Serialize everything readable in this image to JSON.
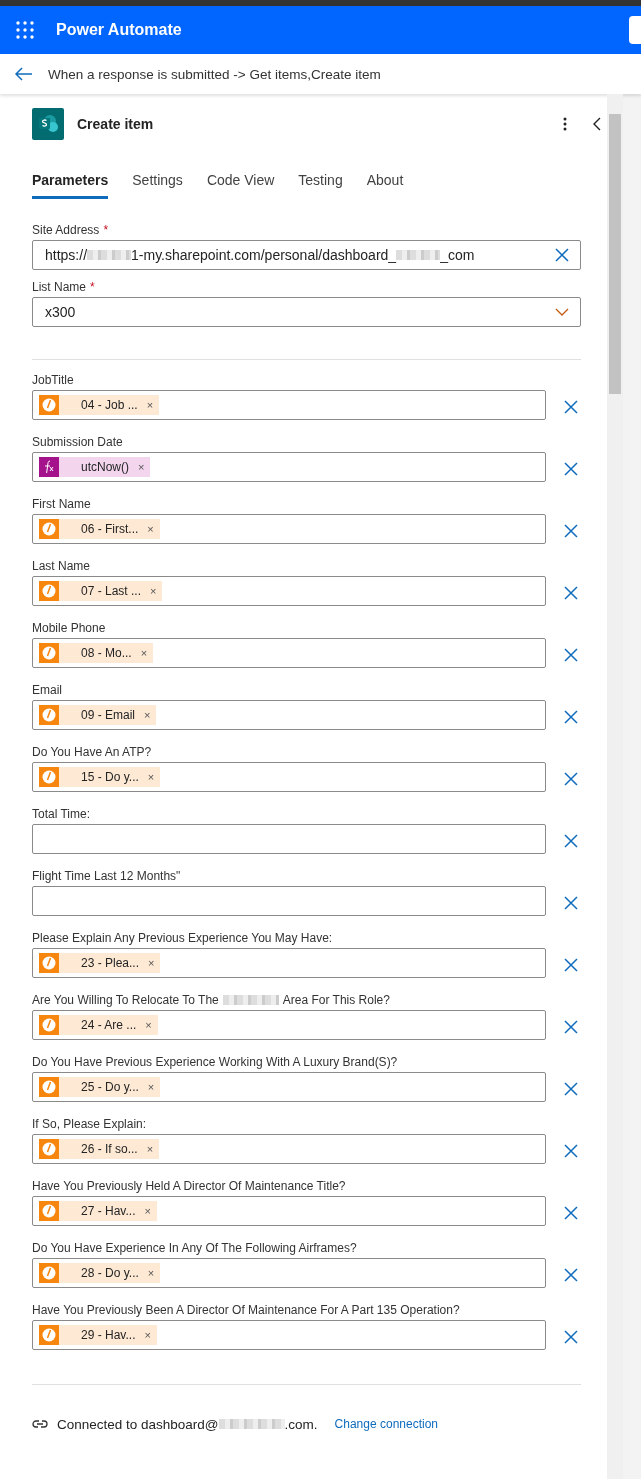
{
  "app": {
    "title": "Power Automate"
  },
  "breadcrumb": "When a response is submitted -> Get items,Create item",
  "action": {
    "title": "Create item"
  },
  "tabs": [
    {
      "label": "Parameters",
      "selected": true
    },
    {
      "label": "Settings",
      "selected": false
    },
    {
      "label": "Code View",
      "selected": false
    },
    {
      "label": "Testing",
      "selected": false
    },
    {
      "label": "About",
      "selected": false
    }
  ],
  "site_address": {
    "label": "Site Address",
    "required": true,
    "required_mark": "*",
    "value_parts": [
      "https://",
      "1-my.sharepoint.com/personal/dashboard_",
      "_com"
    ]
  },
  "list_name": {
    "label": "List Name",
    "required": true,
    "required_mark": "*",
    "value": "x300"
  },
  "fields": [
    {
      "label_parts": [
        "JobTitle"
      ],
      "token": {
        "kind": "dynamic",
        "text": "04 - Job ...",
        "remove": "×"
      }
    },
    {
      "label_parts": [
        "Submission Date"
      ],
      "token": {
        "kind": "expression",
        "text": "utcNow()",
        "remove": "×"
      }
    },
    {
      "label_parts": [
        "First Name"
      ],
      "token": {
        "kind": "dynamic",
        "text": "06 - First...",
        "remove": "×"
      }
    },
    {
      "label_parts": [
        "Last Name"
      ],
      "token": {
        "kind": "dynamic",
        "text": "07 - Last ...",
        "remove": "×"
      }
    },
    {
      "label_parts": [
        "Mobile Phone"
      ],
      "token": {
        "kind": "dynamic",
        "text": "08 - Mo...",
        "remove": "×"
      }
    },
    {
      "label_parts": [
        "Email"
      ],
      "token": {
        "kind": "dynamic",
        "text": "09 - Email",
        "remove": "×"
      }
    },
    {
      "label_parts": [
        "Do You Have An ATP?"
      ],
      "token": {
        "kind": "dynamic",
        "text": "15 - Do y...",
        "remove": "×"
      }
    },
    {
      "label_parts": [
        "Total Time:"
      ]
    },
    {
      "label_parts": [
        "Flight Time Last 12 Months\""
      ]
    },
    {
      "label_parts": [
        "Please Explain Any Previous Experience You May Have:"
      ],
      "token": {
        "kind": "dynamic",
        "text": "23 - Plea...",
        "remove": "×"
      }
    },
    {
      "label_parts": [
        "Are You Willing To Relocate To The",
        "Area For This Role?"
      ],
      "token": {
        "kind": "dynamic",
        "text": "24 - Are ...",
        "remove": "×"
      }
    },
    {
      "label_parts": [
        "Do You Have Previous Experience Working With A Luxury Brand(S)?"
      ],
      "token": {
        "kind": "dynamic",
        "text": "25 - Do y...",
        "remove": "×"
      }
    },
    {
      "label_parts": [
        "If So, Please Explain:"
      ],
      "token": {
        "kind": "dynamic",
        "text": "26 - If so...",
        "remove": "×"
      }
    },
    {
      "label_parts": [
        "Have You Previously Held A Director Of Maintenance Title?"
      ],
      "token": {
        "kind": "dynamic",
        "text": "27 - Hav...",
        "remove": "×"
      }
    },
    {
      "label_parts": [
        "Do You Have Experience In Any Of The Following Airframes?"
      ],
      "token": {
        "kind": "dynamic",
        "text": "28 - Do y...",
        "remove": "×"
      }
    },
    {
      "label_parts": [
        "Have You Previously Been A Director Of Maintenance For A Part 135 Operation?"
      ],
      "token": {
        "kind": "dynamic",
        "text": "29 - Hav...",
        "remove": "×"
      }
    }
  ],
  "connection": {
    "text_parts": [
      "Connected to dashboard@",
      ".com."
    ],
    "link": "Change connection"
  }
}
